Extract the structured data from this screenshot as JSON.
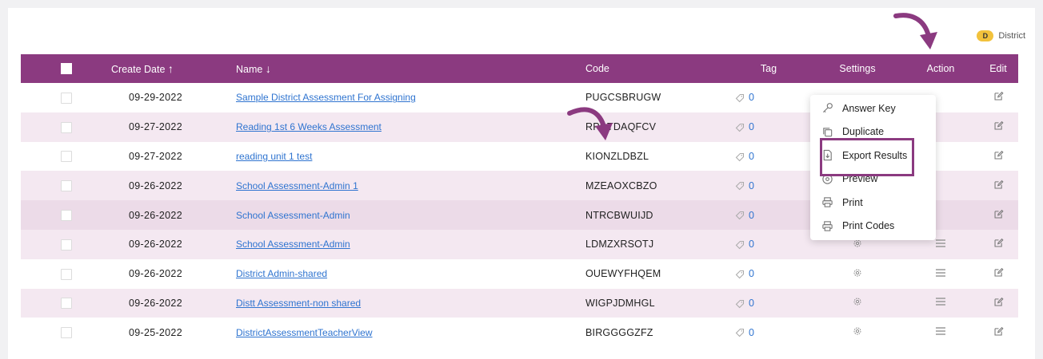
{
  "legend": {
    "badge": "D",
    "label": "District"
  },
  "table": {
    "headers": {
      "create_date": "Create Date",
      "name": "Name",
      "code": "Code",
      "tag": "Tag",
      "settings": "Settings",
      "action": "Action",
      "edit": "Edit"
    },
    "rows": [
      {
        "date": "09-29-2022",
        "name": "Sample District Assessment For Assigning",
        "code": "PUGCSBRUGW",
        "tag": "0"
      },
      {
        "date": "09-27-2022",
        "name": "Reading 1st 6 Weeks Assessment",
        "code": "RPDTDAQFCV",
        "tag": "0"
      },
      {
        "date": "09-27-2022",
        "name": "reading unit 1 test",
        "code": "KIONZLDBZL",
        "tag": "0"
      },
      {
        "date": "09-26-2022",
        "name": "School Assessment-Admin 1",
        "code": "MZEAOXCBZO",
        "tag": "0"
      },
      {
        "date": "09-26-2022",
        "name": "School Assessment-Admin",
        "code": "NTRCBWUIJD",
        "tag": "0"
      },
      {
        "date": "09-26-2022",
        "name": "School Assessment-Admin",
        "code": "LDMZXRSOTJ",
        "tag": "0"
      },
      {
        "date": "09-26-2022",
        "name": "District Admin-shared",
        "code": "OUEWYFHQEM",
        "tag": "0"
      },
      {
        "date": "09-26-2022",
        "name": "Distt Assessment-non shared",
        "code": "WIGPJDMHGL",
        "tag": "0"
      },
      {
        "date": "09-25-2022",
        "name": "DistrictAssessmentTeacherView",
        "code": "BIRGGGGZFZ",
        "tag": "0"
      }
    ]
  },
  "action_menu": {
    "items": [
      "Answer Key",
      "Duplicate",
      "Export Results",
      "Preview",
      "Print",
      "Print Codes"
    ],
    "highlighted": "Export Results"
  },
  "colors": {
    "header_bg": "#8b3a80",
    "link": "#2f74d0",
    "badge": "#f2c23c",
    "row_alt": "#f4e8f1"
  },
  "icons": {
    "sort_asc": "arrow-up-icon",
    "sort_desc": "arrow-down-icon",
    "tag": "tag-icon",
    "settings": "gear-icon",
    "action": "hamburger-icon",
    "edit": "edit-icon"
  }
}
